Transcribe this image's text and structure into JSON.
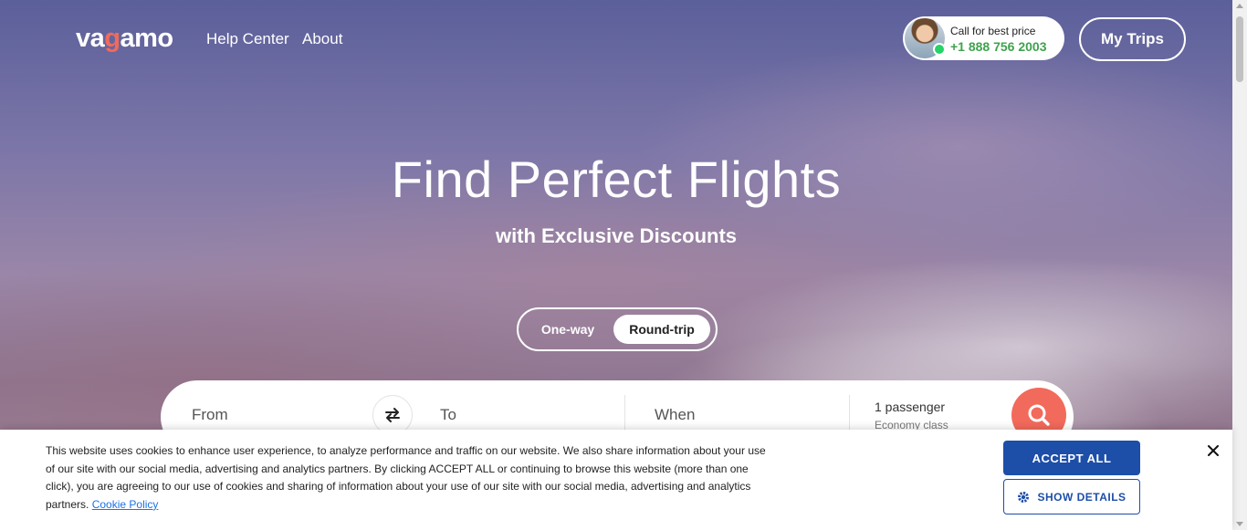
{
  "header": {
    "logo_text_1": "va",
    "logo_text_g": "g",
    "logo_text_2": "amo",
    "nav": {
      "help_center": "Help Center",
      "about": "About"
    },
    "call": {
      "label": "Call for best price",
      "phone": "+1 888 756 2003"
    },
    "my_trips": "My Trips"
  },
  "hero": {
    "title": "Find Perfect Flights",
    "subtitle": "with Exclusive Discounts"
  },
  "trip_type": {
    "options": [
      "One-way",
      "Round-trip"
    ],
    "selected": "Round-trip"
  },
  "search": {
    "from_placeholder": "From",
    "to_placeholder": "To",
    "when_placeholder": "When",
    "passengers": "1 passenger",
    "cabin_class": "Economy class"
  },
  "cookie_banner": {
    "text": "This website uses cookies to enhance user experience, to analyze performance and traffic on our website. We also share information about your use of our site with our social media, advertising and analytics partners. By clicking ACCEPT ALL or continuing to browse this website (more than one click), you are agreeing to our use of cookies and sharing of information about your use of our site with our social media, advertising and analytics partners.",
    "policy_link": "Cookie Policy",
    "accept_all": "ACCEPT ALL",
    "show_details": "SHOW DETAILS"
  },
  "colors": {
    "brand_coral": "#f26a5b",
    "phone_green": "#3fa34d",
    "cookie_blue": "#1d4ea8"
  }
}
